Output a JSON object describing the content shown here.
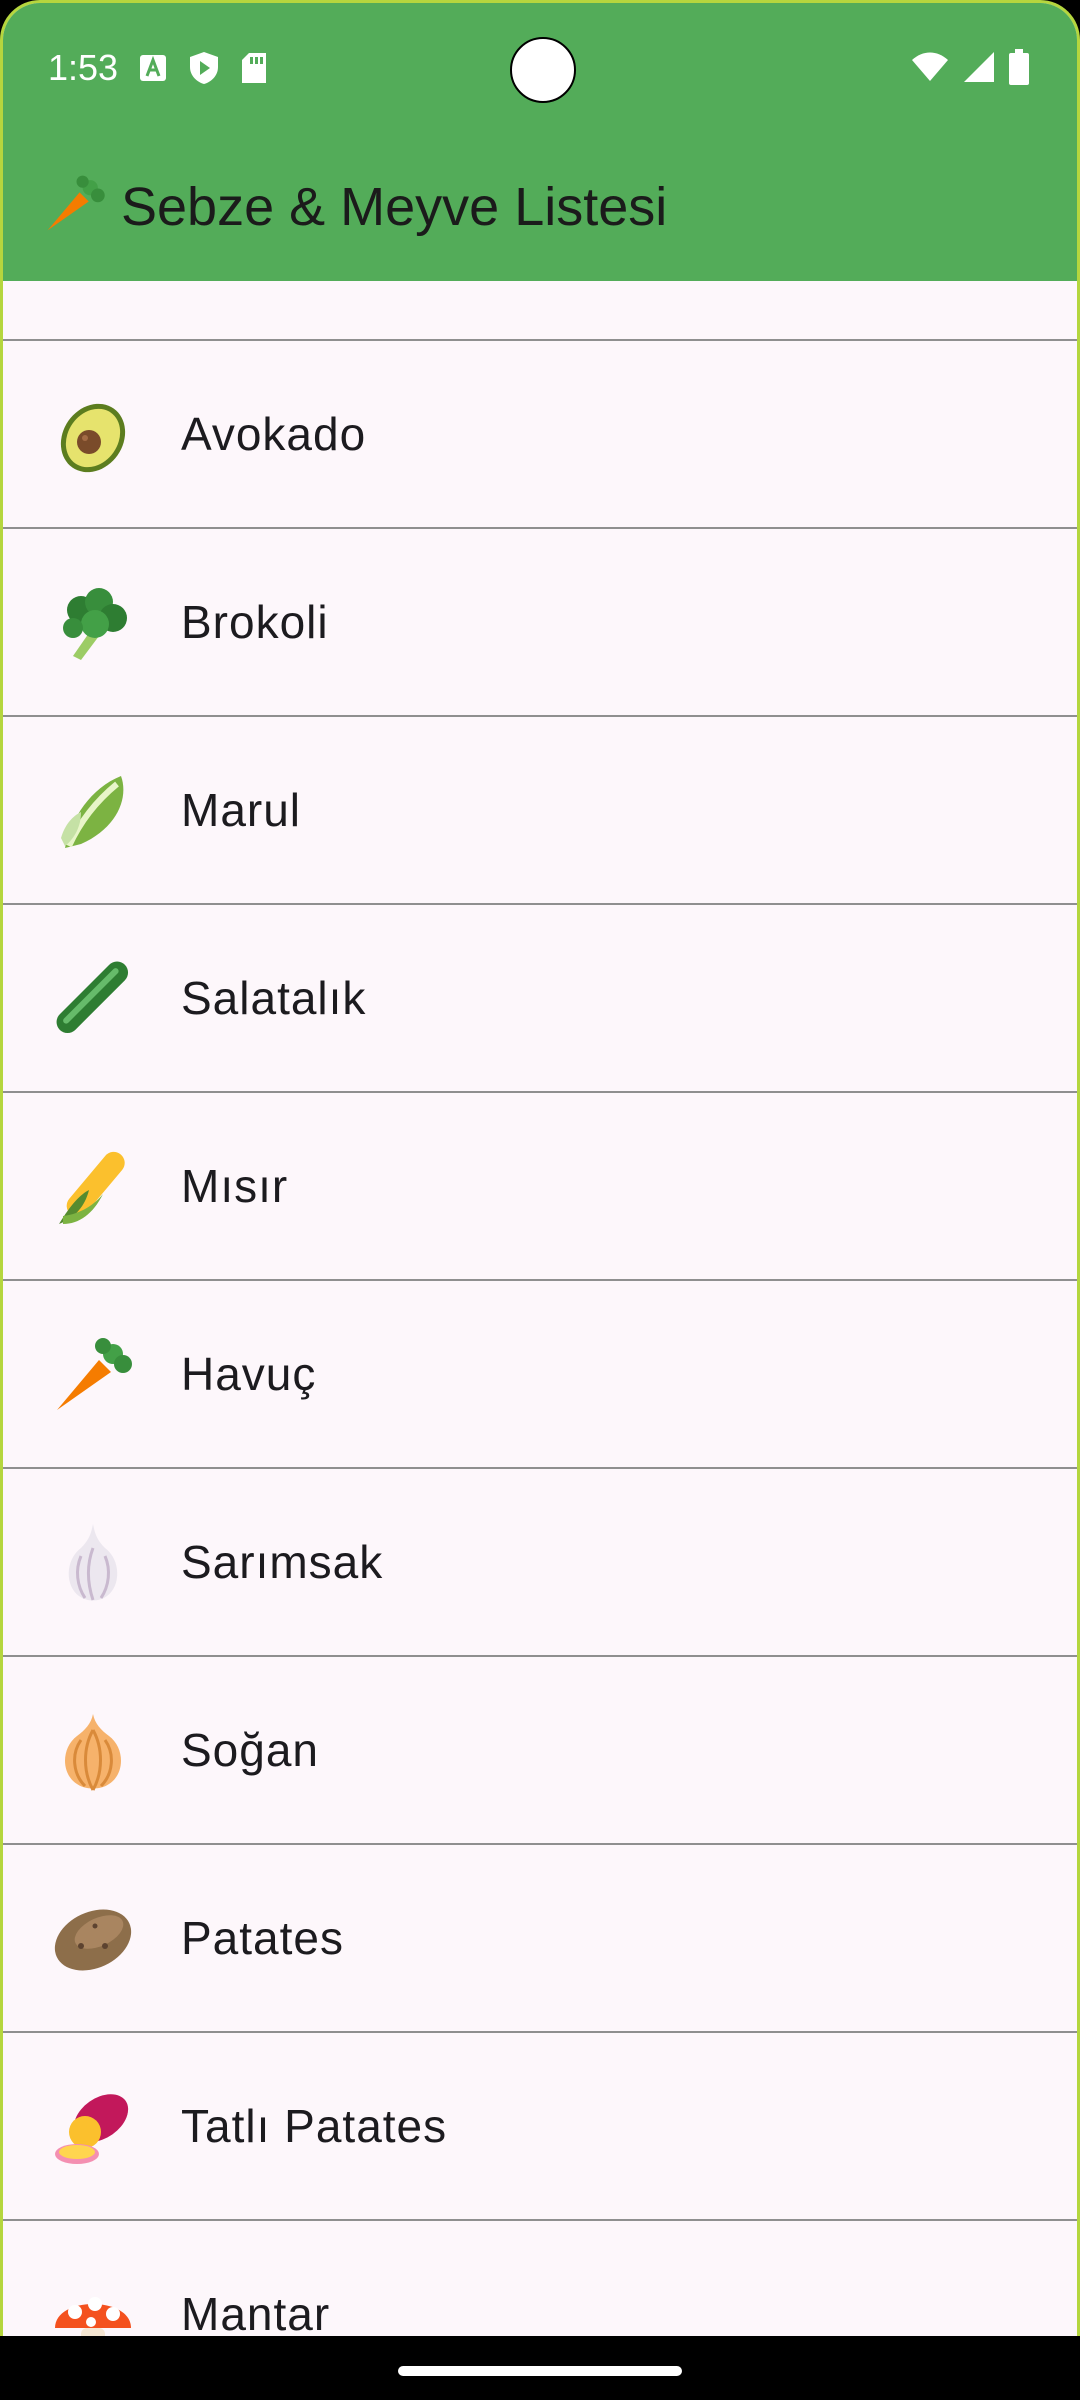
{
  "status_bar": {
    "time": "1:53",
    "left_icons": [
      "a-icon",
      "shield-play-icon",
      "sd-card-icon"
    ],
    "right_icons": [
      "wifi-icon",
      "signal-icon",
      "battery-icon"
    ]
  },
  "app_bar": {
    "title_icon": "🥕",
    "title": "Sebze & Meyve Listesi",
    "background_color": "#53ac59"
  },
  "list": {
    "items": [
      {
        "icon": "eggplant-icon",
        "label": ""
      },
      {
        "icon": "avocado-icon",
        "label": "Avokado"
      },
      {
        "icon": "broccoli-icon",
        "label": "Brokoli"
      },
      {
        "icon": "lettuce-icon",
        "label": "Marul"
      },
      {
        "icon": "cucumber-icon",
        "label": "Salatalık"
      },
      {
        "icon": "corn-icon",
        "label": "Mısır"
      },
      {
        "icon": "carrot-icon",
        "label": "Havuç"
      },
      {
        "icon": "garlic-icon",
        "label": "Sarımsak"
      },
      {
        "icon": "onion-icon",
        "label": "Soğan"
      },
      {
        "icon": "potato-icon",
        "label": "Patates"
      },
      {
        "icon": "sweet-potato-icon",
        "label": "Tatlı Patates"
      },
      {
        "icon": "mushroom-icon",
        "label": "Mantar"
      }
    ]
  }
}
